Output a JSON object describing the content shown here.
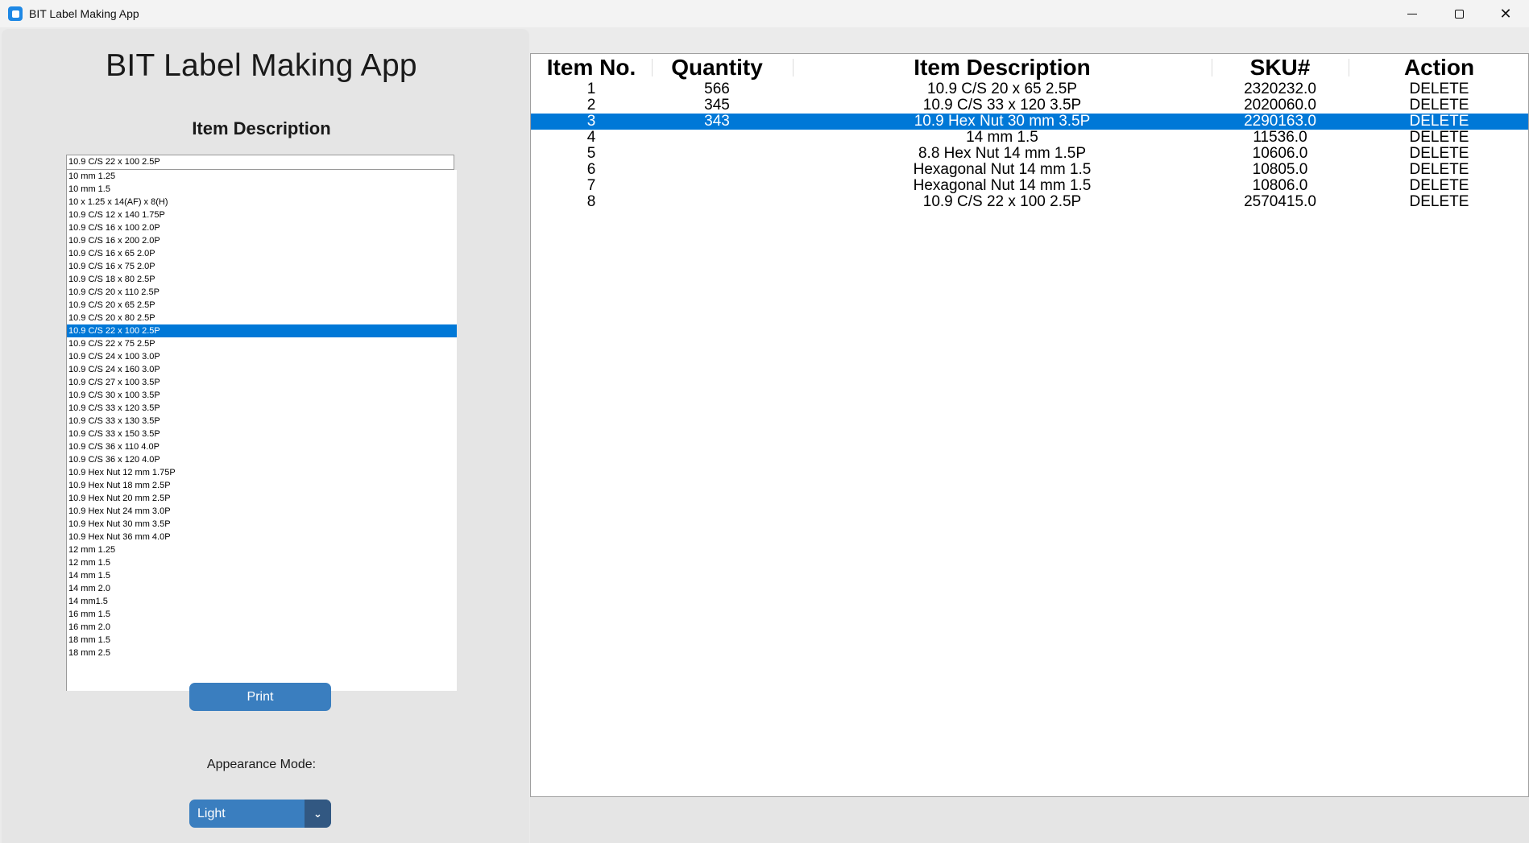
{
  "window": {
    "title": "BIT Label Making App",
    "controls": {
      "minimize": "minimize",
      "maximize": "maximize",
      "close": "✕"
    }
  },
  "left": {
    "heading": "BIT Label Making App",
    "section_label": "Item Description",
    "combo_value": "10.9 C/S 22 x 100 2.5P",
    "list_items": [
      "10 mm 1.25",
      "10 mm 1.5",
      "10 x 1.25 x 14(AF) x 8(H)",
      "10.9 C/S 12 x 140 1.75P",
      "10.9 C/S 16 x 100 2.0P",
      "10.9 C/S 16 x 200 2.0P",
      "10.9 C/S 16 x 65 2.0P",
      "10.9 C/S 16 x 75 2.0P",
      "10.9 C/S 18 x 80 2.5P",
      "10.9 C/S 20 x 110 2.5P",
      "10.9 C/S 20 x 65 2.5P",
      "10.9 C/S 20 x 80 2.5P",
      "10.9 C/S 22 x 100 2.5P",
      "10.9 C/S 22 x 75 2.5P",
      "10.9 C/S 24 x 100 3.0P",
      "10.9 C/S 24 x 160 3.0P",
      "10.9 C/S 27 x 100 3.5P",
      "10.9 C/S 30 x 100 3.5P",
      "10.9 C/S 33 x 120 3.5P",
      "10.9 C/S 33 x 130 3.5P",
      "10.9 C/S 33 x 150 3.5P",
      "10.9 C/S 36 x 110 4.0P",
      "10.9 C/S 36 x 120 4.0P",
      "10.9 Hex Nut 12 mm 1.75P",
      "10.9 Hex Nut 18 mm 2.5P",
      "10.9 Hex Nut 20 mm 2.5P",
      "10.9 Hex Nut 24 mm 3.0P",
      "10.9 Hex Nut 30 mm 3.5P",
      "10.9 Hex Nut 36 mm 4.0P",
      "12 mm 1.25",
      "12 mm 1.5",
      "14 mm 1.5",
      "14 mm 2.0",
      "14 mm1.5",
      "16 mm 1.5",
      "16 mm 2.0",
      "18 mm 1.5",
      "18 mm 2.5"
    ],
    "selected_list_index": 12,
    "print_label": "Print",
    "appearance_label": "Appearance Mode:",
    "appearance_value": "Light",
    "appearance_arrow": "⌄"
  },
  "table": {
    "headers": [
      "Item No.",
      "Quantity",
      "Item Description",
      "SKU#",
      "Action"
    ],
    "selected_row_index": 2,
    "rows": [
      {
        "item_no": "1",
        "quantity": "566",
        "description": "10.9 C/S 20 x 65 2.5P",
        "sku": "2320232.0",
        "action": "DELETE"
      },
      {
        "item_no": "2",
        "quantity": "345",
        "description": "10.9 C/S 33 x 120 3.5P",
        "sku": "2020060.0",
        "action": "DELETE"
      },
      {
        "item_no": "3",
        "quantity": "343",
        "description": "10.9 Hex Nut 30 mm 3.5P",
        "sku": "2290163.0",
        "action": "DELETE"
      },
      {
        "item_no": "4",
        "quantity": "",
        "description": "14 mm 1.5",
        "sku": "11536.0",
        "action": "DELETE"
      },
      {
        "item_no": "5",
        "quantity": "",
        "description": "8.8 Hex Nut 14 mm 1.5P",
        "sku": "10606.0",
        "action": "DELETE"
      },
      {
        "item_no": "6",
        "quantity": "",
        "description": "Hexagonal Nut 14 mm 1.5",
        "sku": "10805.0",
        "action": "DELETE"
      },
      {
        "item_no": "7",
        "quantity": "",
        "description": "Hexagonal Nut 14 mm 1.5",
        "sku": "10806.0",
        "action": "DELETE"
      },
      {
        "item_no": "8",
        "quantity": "",
        "description": "10.9 C/S 22 x 100 2.5P",
        "sku": "2570415.0",
        "action": "DELETE"
      }
    ]
  },
  "colors": {
    "accent": "#3a7ebf",
    "accent_dark": "#325882",
    "selection": "#0078d7",
    "panel": "#e5e5e5"
  }
}
